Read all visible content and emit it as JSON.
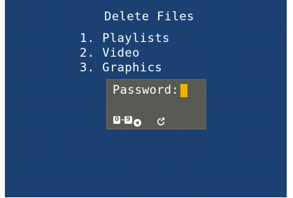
{
  "screen": {
    "title": "Delete Files",
    "menu": [
      {
        "label": "1. Playlists"
      },
      {
        "label": "2. Video"
      },
      {
        "label": "3. Graphics"
      }
    ]
  },
  "dialog": {
    "prompt": "Password:",
    "hints": {
      "key_from": "0",
      "separator": "-",
      "key_to": "9",
      "back_icon": "back-triangle-icon",
      "confirm_icon": "confirm-enter-icon"
    }
  },
  "colors": {
    "background": "#1a3f72",
    "dialog": "#5a5a55",
    "cursor": "#f0b400",
    "text": "#ffffff"
  }
}
